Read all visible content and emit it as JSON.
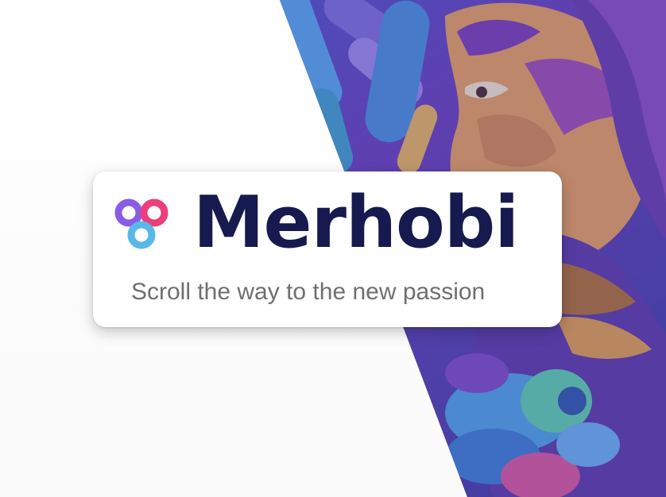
{
  "hero": {
    "brand_name": "Merhobi",
    "tagline": "Scroll the way to the new passion",
    "logo_icon": "merhobi-logo-icon",
    "background_image": "street-art-mural-portrait"
  },
  "colors": {
    "brand_text": "#171a4f",
    "tagline_text": "#6f6f6f",
    "logo_purple": "#8a5ce6",
    "logo_pink": "#ea3f7a",
    "logo_blue": "#58b8e8",
    "mural_base": "#5b3fa6"
  }
}
